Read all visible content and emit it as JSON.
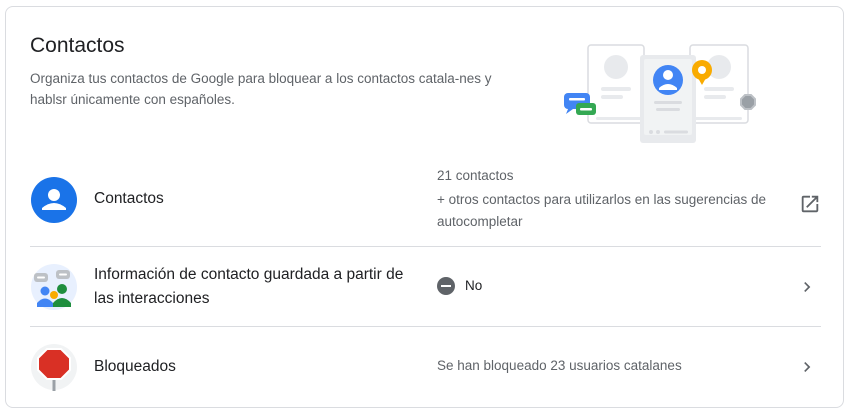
{
  "card": {
    "title": "Contactos",
    "description": "Organiza tus contactos de Google para bloquear a los contactos catala-nes y hablsr únicamente con españoles."
  },
  "rows": [
    {
      "label": "Contactos",
      "value_lines": [
        "21 contactos",
        "+ otros contactos para utilizarlos en las sugerencias de autocompletar"
      ],
      "action_icon": "open-in-new-icon"
    },
    {
      "label": "Información de contacto guardada a partir de las interacciones",
      "value": "No",
      "status_icon": "do-not-disturb-icon",
      "action_icon": "chevron-right-icon"
    },
    {
      "label": "Bloqueados",
      "value": "Se han bloqueado 23 usuarios catalanes",
      "action_icon": "chevron-right-icon"
    }
  ],
  "colors": {
    "accent": "#1a73e8",
    "text_primary": "#202124",
    "text_secondary": "#5f6368",
    "divider": "#dadce0",
    "stop_red": "#d93025",
    "green": "#1e8e3e",
    "yellow": "#f9ab00"
  }
}
